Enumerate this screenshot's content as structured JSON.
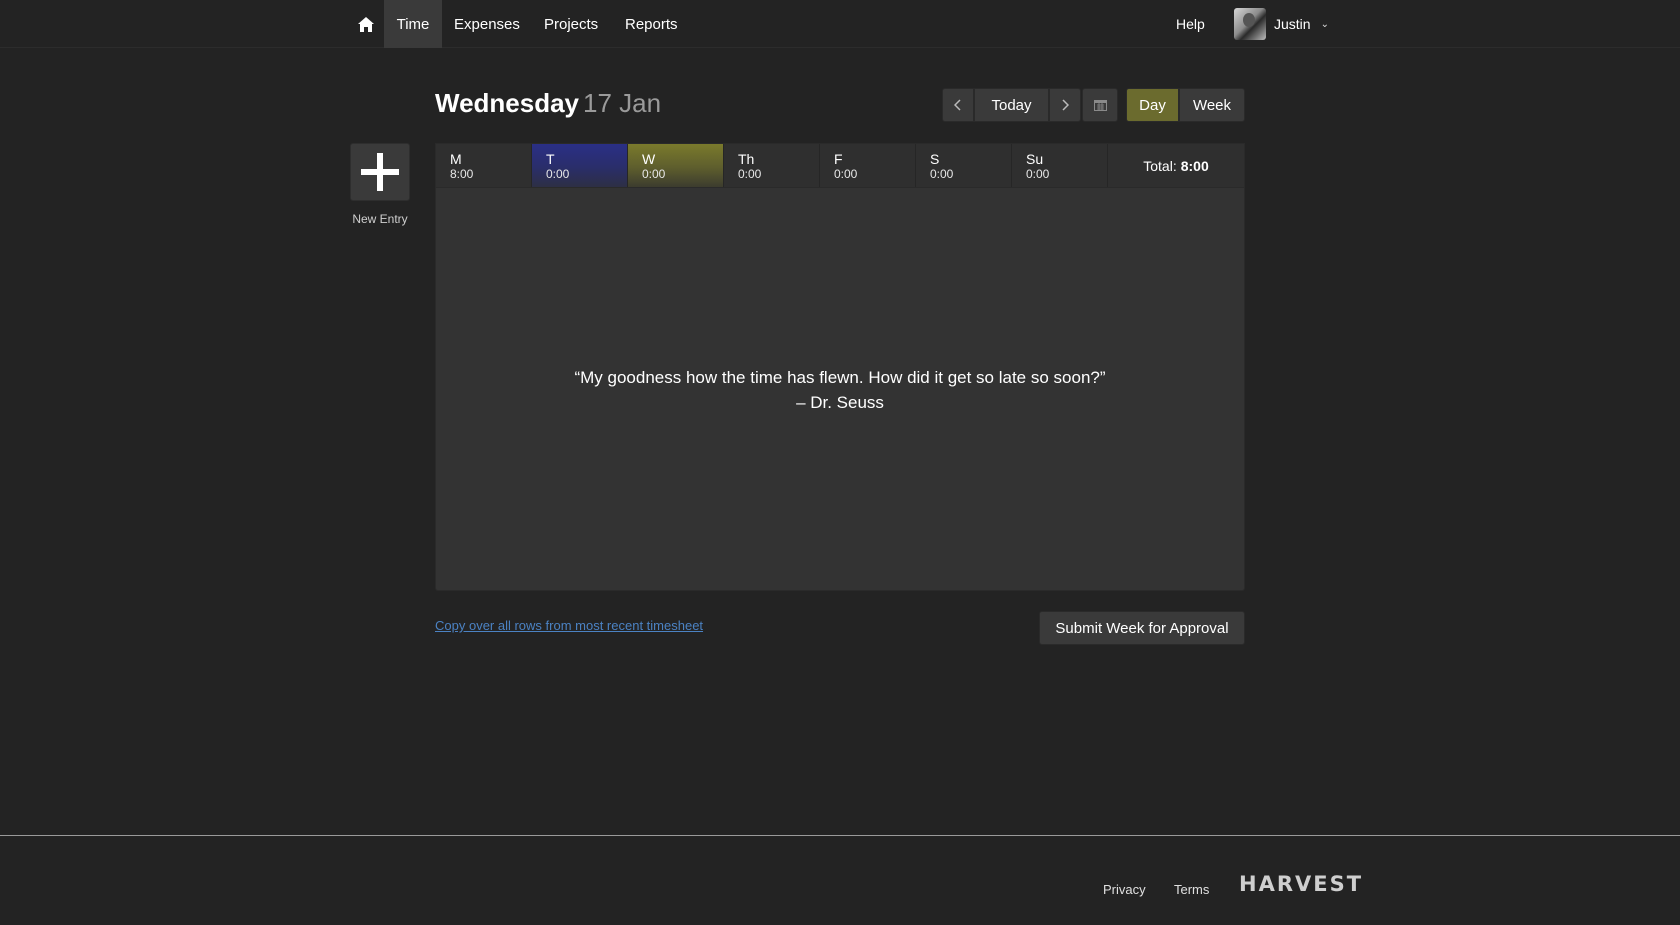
{
  "nav": {
    "items": [
      {
        "label": "Time",
        "active": true
      },
      {
        "label": "Expenses",
        "active": false
      },
      {
        "label": "Projects",
        "active": false
      },
      {
        "label": "Reports",
        "active": false
      }
    ],
    "help": "Help",
    "user": "Justin"
  },
  "header": {
    "weekday": "Wednesday",
    "date": "17 Jan",
    "today_label": "Today",
    "day_label": "Day",
    "week_label": "Week"
  },
  "new_entry": {
    "label": "New Entry"
  },
  "days": [
    {
      "name": "M",
      "time": "8:00"
    },
    {
      "name": "T",
      "time": "0:00"
    },
    {
      "name": "W",
      "time": "0:00"
    },
    {
      "name": "Th",
      "time": "0:00"
    },
    {
      "name": "F",
      "time": "0:00"
    },
    {
      "name": "S",
      "time": "0:00"
    },
    {
      "name": "Su",
      "time": "0:00"
    }
  ],
  "total": {
    "label": "Total:",
    "value": "8:00"
  },
  "quote": {
    "text": "“My goodness how the time has flewn. How did it get so late so soon?”",
    "author": "– Dr. Seuss"
  },
  "actions": {
    "copy_link": "Copy over all rows from most recent timesheet",
    "submit": "Submit Week for Approval"
  },
  "footer": {
    "privacy": "Privacy",
    "terms": "Terms",
    "logo": "HARVEST"
  },
  "colors": {
    "background": "#232323",
    "day_active": "#6b6b2e",
    "tuesday": "#2a2f86",
    "wednesday": "#7a7a2c",
    "link": "#4b82c3"
  }
}
